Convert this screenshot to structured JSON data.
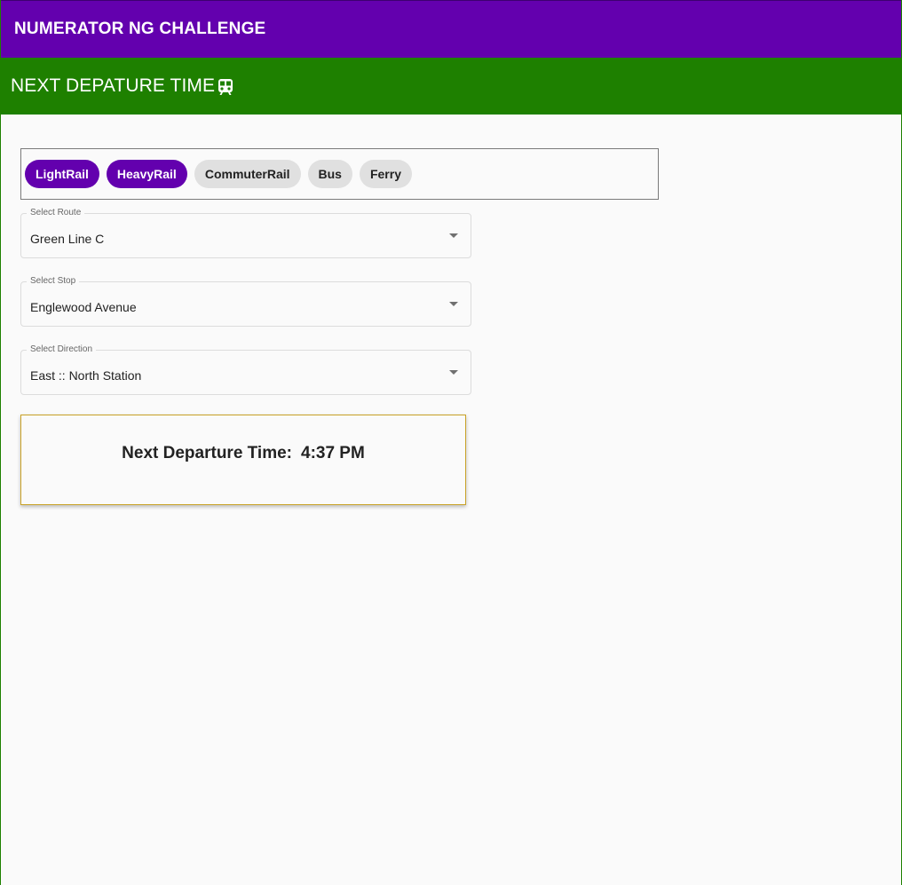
{
  "header": {
    "app_title": "NUMERATOR NG CHALLENGE",
    "section_title": "NEXT DEPATURE TIME",
    "section_icon": "train-icon"
  },
  "modes": [
    {
      "label": "LightRail",
      "selected": true
    },
    {
      "label": "HeavyRail",
      "selected": true
    },
    {
      "label": "CommuterRail",
      "selected": false
    },
    {
      "label": "Bus",
      "selected": false
    },
    {
      "label": "Ferry",
      "selected": false
    }
  ],
  "fields": {
    "route": {
      "label": "Select Route",
      "value": "Green Line C"
    },
    "stop": {
      "label": "Select Stop",
      "value": "Englewood Avenue"
    },
    "direction": {
      "label": "Select Direction",
      "value": "East :: North Station"
    }
  },
  "result": {
    "label": "Next Departure Time:",
    "time": "4:37 PM"
  },
  "colors": {
    "primary": "#6300ae",
    "secondary": "#1e8000",
    "card_border": "#c9a227",
    "chip_default": "#e0e0e0"
  }
}
